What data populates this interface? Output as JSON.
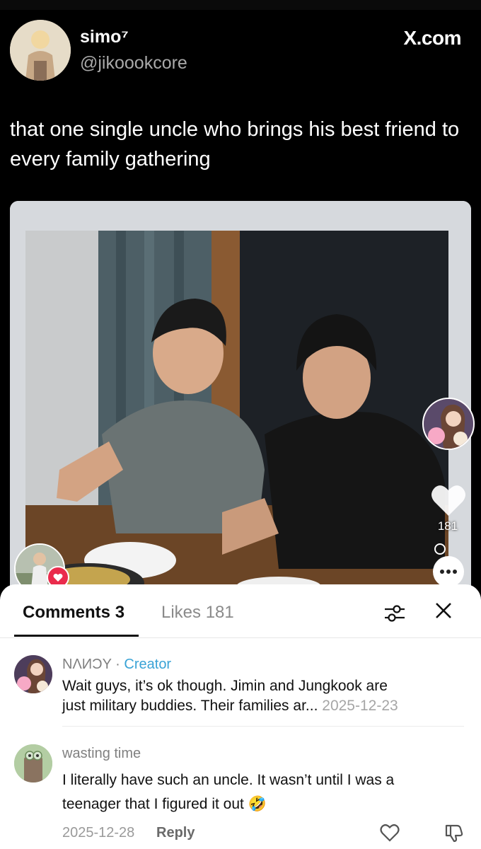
{
  "post": {
    "username": "simo⁷",
    "handle": "@jikoookcore",
    "source": "X.com",
    "text": "that one single uncle who brings his best friend to every family gathering"
  },
  "overlay": {
    "like_count": "181"
  },
  "sheet": {
    "tab_comments": "Comments 3",
    "tab_likes": "Likes 181"
  },
  "comments": [
    {
      "author": "NΛИƆY",
      "separator": "·",
      "badge": "Creator",
      "text_line1": "Wait guys, it’s ok though. Jimin and Jungkook are",
      "text_line2": "just military buddies.  Their families ar...",
      "date": "2025-12-23"
    },
    {
      "author": "wasting time",
      "text_line1": "I literally have such an uncle. It wasn’t until I was a",
      "text_line2": "teenager that I figured it out",
      "emoji": "🤣",
      "date": "2025-12-28",
      "reply_label": "Reply"
    }
  ],
  "colors": {
    "background": "#000000",
    "sheet": "#ffffff",
    "creator_badge": "#3aa3d6",
    "heart_badge": "#ea2b4c"
  },
  "icons": [
    "avatar",
    "heart-icon",
    "more-icon",
    "filter-icon",
    "close-icon",
    "like-outline-icon",
    "dislike-icon"
  ]
}
